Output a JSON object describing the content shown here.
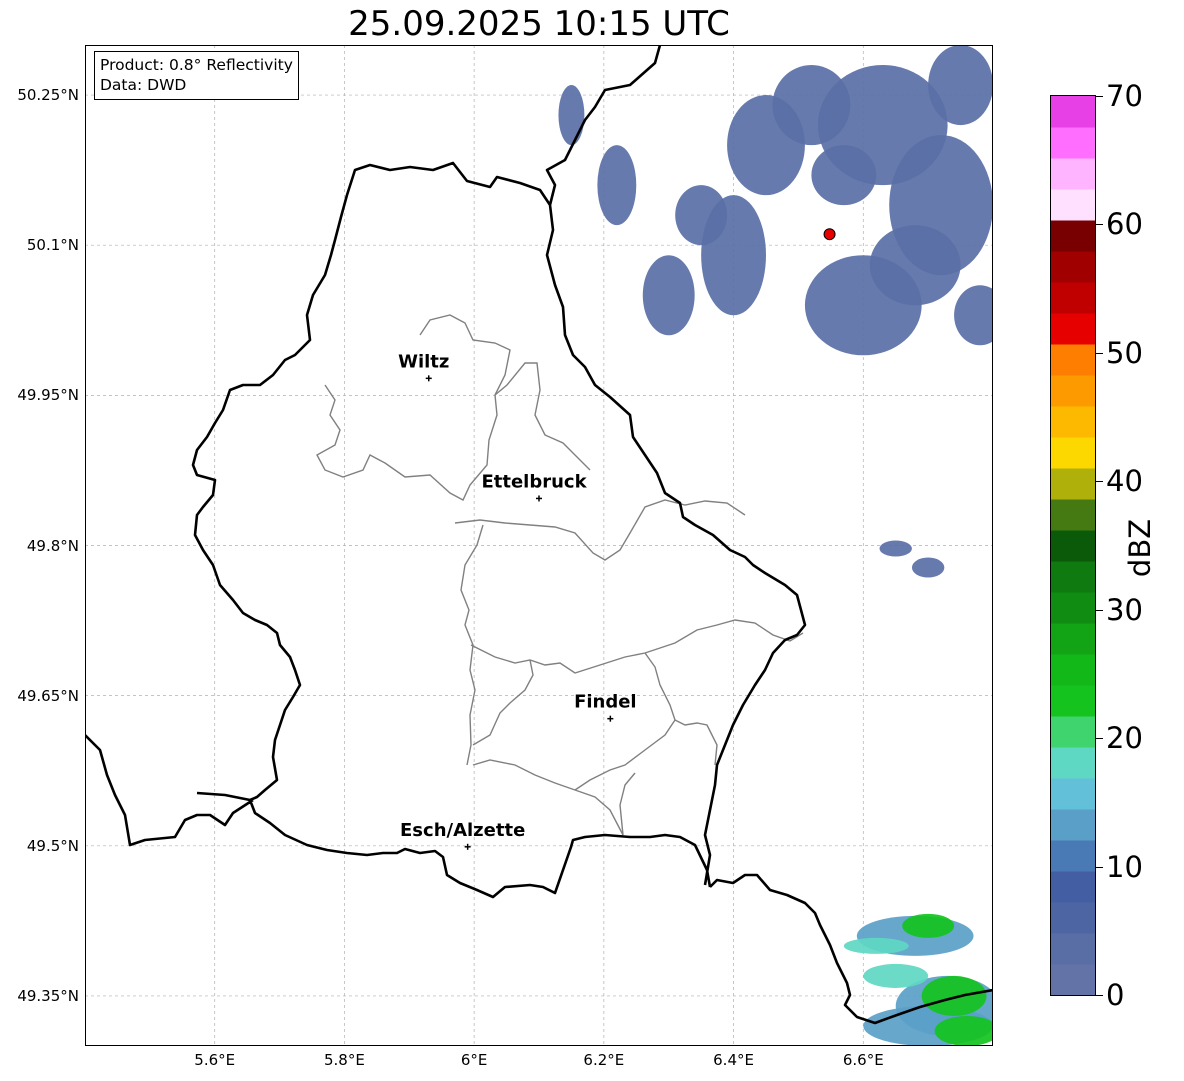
{
  "title": "25.09.2025 10:15 UTC",
  "info": {
    "product": "Product: 0.8° Reflectivity",
    "source": "Data: DWD"
  },
  "map": {
    "extent": {
      "lon_min": 5.4,
      "lon_max": 6.8,
      "lat_min": 49.3,
      "lat_max": 50.3
    },
    "lat_ticks": [
      {
        "value": 50.25,
        "label": "50.25°N"
      },
      {
        "value": 50.1,
        "label": "50.1°N"
      },
      {
        "value": 49.95,
        "label": "49.95°N"
      },
      {
        "value": 49.8,
        "label": "49.8°N"
      },
      {
        "value": 49.65,
        "label": "49.65°N"
      },
      {
        "value": 49.5,
        "label": "49.5°N"
      },
      {
        "value": 49.35,
        "label": "49.35°N"
      }
    ],
    "lon_ticks": [
      {
        "value": 5.6,
        "label": "5.6°E"
      },
      {
        "value": 5.8,
        "label": "5.8°E"
      },
      {
        "value": 6.0,
        "label": "6°E"
      },
      {
        "value": 6.2,
        "label": "6.2°E"
      },
      {
        "value": 6.4,
        "label": "6.4°E"
      },
      {
        "value": 6.6,
        "label": "6.6°E"
      }
    ],
    "cities": [
      {
        "name": "Wiltz",
        "lon": 5.93,
        "lat": 49.967
      },
      {
        "name": "Ettelbruck",
        "lon": 6.1,
        "lat": 49.847
      },
      {
        "name": "Findel",
        "lon": 6.21,
        "lat": 49.627
      },
      {
        "name": "Esch/Alzette",
        "lon": 5.99,
        "lat": 49.499
      }
    ],
    "radar_site": {
      "lon": 6.548,
      "lat": 50.111,
      "color": "#e80000"
    },
    "colors": {
      "country_border": "#000000",
      "canton_border": "#808080",
      "grid": "#b0b0b0"
    },
    "echo_areas": [
      {
        "id": "northeast-light",
        "dbz": 3,
        "color": "#5a6fa6",
        "cells": [
          [
            6.63,
            50.22,
            0.1,
            0.06
          ],
          [
            6.72,
            50.14,
            0.08,
            0.07
          ],
          [
            6.6,
            50.04,
            0.09,
            0.05
          ],
          [
            6.45,
            50.2,
            0.06,
            0.05
          ],
          [
            6.4,
            50.09,
            0.05,
            0.06
          ],
          [
            6.3,
            50.05,
            0.04,
            0.04
          ],
          [
            6.22,
            50.16,
            0.03,
            0.04
          ],
          [
            6.15,
            50.23,
            0.02,
            0.03
          ],
          [
            6.75,
            50.26,
            0.05,
            0.04
          ],
          [
            6.52,
            50.24,
            0.06,
            0.04
          ],
          [
            6.68,
            50.08,
            0.07,
            0.04
          ],
          [
            6.35,
            50.13,
            0.04,
            0.03
          ],
          [
            6.78,
            50.03,
            0.04,
            0.03
          ],
          [
            6.57,
            50.17,
            0.05,
            0.03
          ]
        ]
      },
      {
        "id": "east-small",
        "dbz": 5,
        "color": "#5a6fa6",
        "cells": [
          [
            6.65,
            49.797,
            0.025,
            0.008
          ],
          [
            6.7,
            49.778,
            0.025,
            0.01
          ]
        ]
      },
      {
        "id": "southeast-light",
        "dbz": 12,
        "color": "#5aa0c8",
        "cells": [
          [
            6.68,
            49.41,
            0.09,
            0.02
          ],
          [
            6.73,
            49.34,
            0.08,
            0.03
          ],
          [
            6.7,
            49.32,
            0.1,
            0.02
          ]
        ]
      },
      {
        "id": "southeast-moderate",
        "dbz": 22,
        "color": "#14c31e",
        "cells": [
          [
            6.7,
            49.42,
            0.04,
            0.012
          ],
          [
            6.74,
            49.35,
            0.05,
            0.02
          ],
          [
            6.76,
            49.315,
            0.05,
            0.015
          ]
        ]
      },
      {
        "id": "southeast-teal",
        "dbz": 16,
        "color": "#5ed8c3",
        "cells": [
          [
            6.65,
            49.37,
            0.05,
            0.012
          ],
          [
            6.62,
            49.4,
            0.05,
            0.008
          ]
        ]
      }
    ]
  },
  "colorbar": {
    "unit": "dBZ",
    "min": 0,
    "max": 70,
    "ticks": [
      0,
      10,
      20,
      30,
      40,
      50,
      60,
      70
    ],
    "bands": [
      "#6373a8",
      "#5a6ea6",
      "#4d66a3",
      "#435ea2",
      "#4a7ab5",
      "#5a9fc8",
      "#62c0d8",
      "#5ed8c3",
      "#3fd46e",
      "#14c31e",
      "#12b818",
      "#12a414",
      "#108c12",
      "#0e7a10",
      "#0a5a0a",
      "#457a13",
      "#b0b00a",
      "#fcd800",
      "#fdb800",
      "#fd9a00",
      "#fd7e00",
      "#e60000",
      "#c00000",
      "#a00000",
      "#780000",
      "#ffe0ff",
      "#ffb4ff",
      "#ff6eff",
      "#e640e6"
    ]
  }
}
